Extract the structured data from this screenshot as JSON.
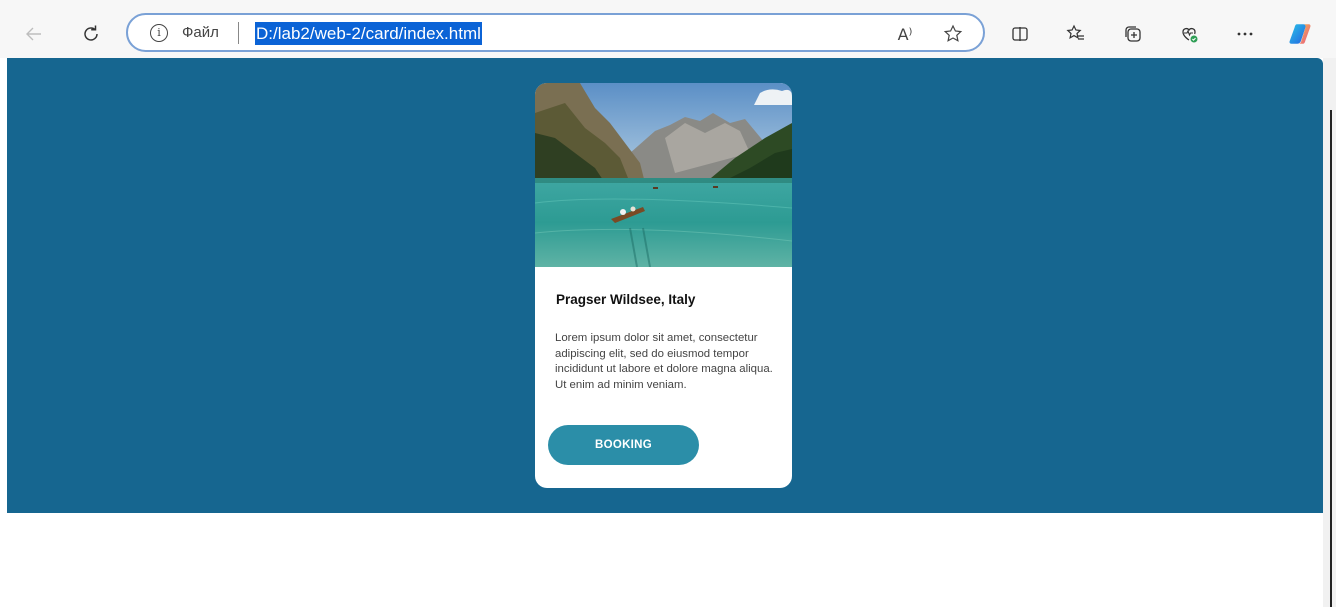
{
  "browser": {
    "address_scheme_label": "Файл",
    "url": "D:/lab2/web-2/card/index.html",
    "read_aloud_glyph": "A⁾"
  },
  "colors": {
    "page_background": "#166690",
    "button": "#2b8ea8",
    "address_highlight": "#0b63d6"
  },
  "card": {
    "title": "Pragser Wildsee, Italy",
    "description": "Lorem ipsum dolor sit amet, consectetur adipiscing elit, sed do eiusmod tempor incididunt ut labore et dolore magna aliqua. Ut enim ad minim veniam.",
    "button_label": "BOOKING",
    "image_subject": "mountain-lake-with-rowboat"
  },
  "icons": [
    "back-arrow-icon",
    "refresh-icon",
    "info-icon",
    "read-aloud-icon",
    "favorite-star-icon",
    "split-screen-icon",
    "favorites-icon",
    "collections-icon",
    "browser-essentials-icon",
    "more-menu-icon",
    "copilot-icon"
  ]
}
